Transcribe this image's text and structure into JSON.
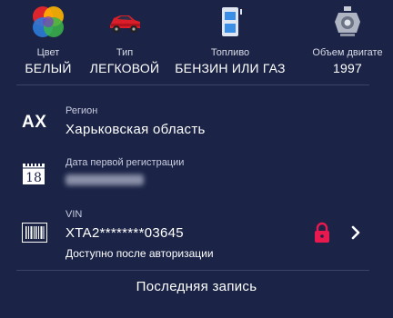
{
  "specs": [
    {
      "label": "Цвет",
      "value": "БЕЛЫЙ",
      "icon": "color-palette-icon"
    },
    {
      "label": "Тип",
      "value": "ЛЕГКОВОЙ",
      "icon": "red-car-icon"
    },
    {
      "label": "Топливо",
      "value": "БЕНЗИН ИЛИ ГАЗ",
      "icon": "fuel-pump-icon"
    },
    {
      "label": "Объем двигате",
      "value": "1997",
      "icon": "engine-icon"
    }
  ],
  "region": {
    "label": "Регион",
    "value": "Харьковская область",
    "plate_code": "AX"
  },
  "registration": {
    "label": "Дата первой регистрации",
    "value": "",
    "calendar_day": "18"
  },
  "vin": {
    "label": "VIN",
    "value": "XTA2********03645",
    "note": "Доступно после авторизации"
  },
  "last_record": {
    "label": "Последняя запись"
  },
  "colors": {
    "background": "#1b2447",
    "divider": "#3a4468",
    "lock": "#e8194f",
    "car": "#d91e2a",
    "fuel": "#3a8ee6"
  }
}
